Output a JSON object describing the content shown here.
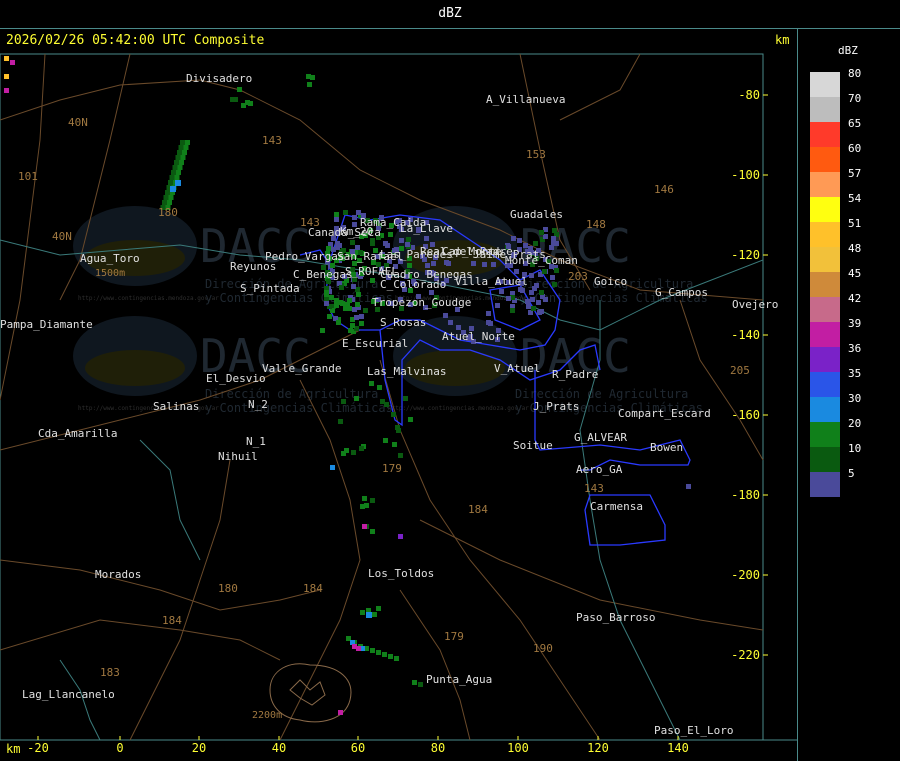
{
  "window": {
    "title": "dBZ"
  },
  "header": {
    "timestamp_label": "2026/02/26 05:42:00 UTC Composite",
    "km_label": "km"
  },
  "axes": {
    "x_unit": "km",
    "y_unit": "km",
    "x_ticks": [
      "-20",
      "0",
      "20",
      "40",
      "60",
      "80",
      "100",
      "120",
      "140"
    ],
    "y_ticks": [
      "-80",
      "-100",
      "-120",
      "-140",
      "-160",
      "-180",
      "-200",
      "-220"
    ]
  },
  "legend": {
    "title": "dBZ",
    "items": [
      {
        "label": "80",
        "color": "#d7d7d7"
      },
      {
        "label": "70",
        "color": "#bdbdbd"
      },
      {
        "label": "65",
        "color": "#ff3a2a"
      },
      {
        "label": "60",
        "color": "#ff5a10"
      },
      {
        "label": "57",
        "color": "#ff9a55"
      },
      {
        "label": "54",
        "color": "#ffff10"
      },
      {
        "label": "51",
        "color": "#ffc12a"
      },
      {
        "label": "48",
        "color": "#f2c13a"
      },
      {
        "label": "45",
        "color": "#cf8a3a"
      },
      {
        "label": "42",
        "color": "#c76a8a"
      },
      {
        "label": "39",
        "color": "#c21ea3"
      },
      {
        "label": "36",
        "color": "#7a22c8"
      },
      {
        "label": "35",
        "color": "#2a55e8"
      },
      {
        "label": "30",
        "color": "#1a8ae0"
      },
      {
        "label": "20",
        "color": "#10801a"
      },
      {
        "label": "10",
        "color": "#0a5a10"
      },
      {
        "label": "5",
        "color": "#4a4a9a"
      }
    ]
  },
  "places": [
    {
      "name": "Divisadero"
    },
    {
      "name": "A_Villanueva"
    },
    {
      "name": "Guadales"
    },
    {
      "name": "Goico"
    },
    {
      "name": "G_Campos"
    },
    {
      "name": "Ovejero"
    },
    {
      "name": "Agua_Toro"
    },
    {
      "name": "Reyunos"
    },
    {
      "name": "S_Pintada"
    },
    {
      "name": "Pampa_Diamante"
    },
    {
      "name": "C_Benegas"
    },
    {
      "name": "S_ROFAEL"
    },
    {
      "name": "C_Colorado"
    },
    {
      "name": "Monte_Coman"
    },
    {
      "name": "E_Escurial"
    },
    {
      "name": "El_Desvio"
    },
    {
      "name": "Valle_Grande"
    },
    {
      "name": "Las_Malvinas"
    },
    {
      "name": "V_Atuel"
    },
    {
      "name": "R_Padre"
    },
    {
      "name": "Salinas"
    },
    {
      "name": "N_2"
    },
    {
      "name": "N_1"
    },
    {
      "name": "Nihuil"
    },
    {
      "name": "Cda_Amarilla"
    },
    {
      "name": "J_Prats"
    },
    {
      "name": "Compart_Escard"
    },
    {
      "name": "G_ALVEAR"
    },
    {
      "name": "Soitue"
    },
    {
      "name": "Bowen"
    },
    {
      "name": "Aero_GA"
    },
    {
      "name": "Carmensa"
    },
    {
      "name": "Morados"
    },
    {
      "name": "Los_Toldos"
    },
    {
      "name": "Paso_Barroso"
    },
    {
      "name": "Punta_Agua"
    },
    {
      "name": "Lag_Llancanelo"
    },
    {
      "name": "Paso_El_Loro"
    },
    {
      "name": "S_Rosas"
    },
    {
      "name": "Atuel_Norte"
    },
    {
      "name": "Pedro_Vargas"
    },
    {
      "name": "Cuadro_Benegas"
    },
    {
      "name": "Tropezon_Goudge"
    },
    {
      "name": "Jaime_Prats"
    },
    {
      "name": "Real_del_Padre"
    },
    {
      "name": "La_Llave"
    },
    {
      "name": "Cap_Monte"
    },
    {
      "name": "Villa_Atuel"
    },
    {
      "name": "Km_20"
    },
    {
      "name": "Las_Paredes"
    },
    {
      "name": "Rama_Caida"
    },
    {
      "name": "Canada_Seca"
    },
    {
      "name": "San_Rafael"
    }
  ],
  "route_numbers": [
    "143",
    "153",
    "146",
    "148",
    "203",
    "101",
    "40N",
    "40N",
    "143",
    "184",
    "180",
    "184",
    "179",
    "184",
    "179",
    "190",
    "180",
    "183",
    "143",
    "205"
  ],
  "elevation_labels": [
    "1500m",
    "2200m"
  ],
  "watermark": {
    "text": "DACC",
    "sub1": "Dirección de Agricultura",
    "sub2": "y Contingencias Climáticas",
    "url": "http://www.contingencias.mendoza.gov.ar"
  }
}
